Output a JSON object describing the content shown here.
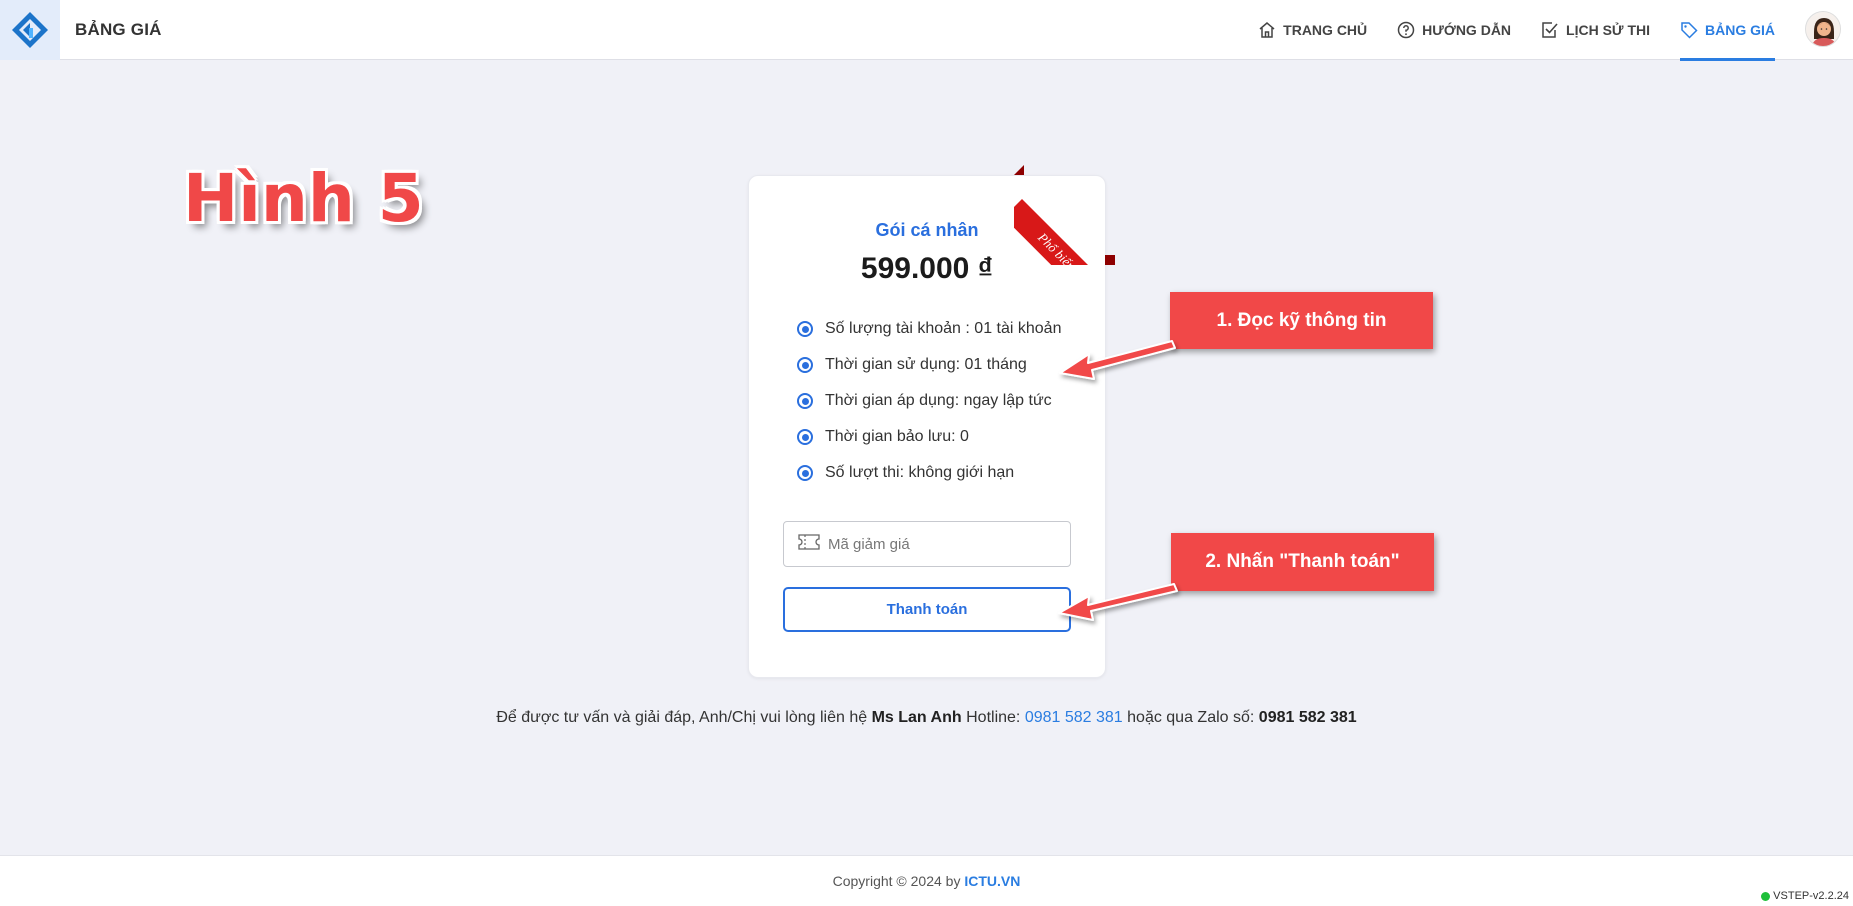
{
  "header": {
    "title": "BẢNG GIÁ",
    "nav": [
      {
        "label": "TRANG CHỦ",
        "icon": "home-icon"
      },
      {
        "label": "HƯỚNG DẪN",
        "icon": "help-icon"
      },
      {
        "label": "LỊCH SỬ THI",
        "icon": "checkbox-icon"
      },
      {
        "label": "BẢNG GIÁ",
        "icon": "price-tag-icon",
        "active": true
      }
    ]
  },
  "figure_label": "Hình 5",
  "plan": {
    "ribbon": "Phổ biến nhất",
    "name": "Gói cá nhân",
    "price": "599.000 ₫",
    "features": [
      "Số lượng tài khoản : 01 tài khoản",
      "Thời gian sử dụng: 01 tháng",
      "Thời gian áp dụng: ngay lập tức",
      "Thời gian bảo lưu: 0",
      "Số lượt thi: không giới hạn"
    ],
    "coupon_placeholder": "Mã giảm giá",
    "pay_label": "Thanh toán"
  },
  "callouts": {
    "step1": "1. Đọc kỹ thông tin",
    "step2": "2. Nhấn \"Thanh toán\""
  },
  "contact": {
    "prefix": "Để được tư vấn và giải đáp, Anh/Chị vui lòng liên hệ",
    "name": "Ms Lan Anh",
    "hotline_label": "Hotline:",
    "hotline": "0981 582 381",
    "zalo_label": "hoặc qua Zalo số:",
    "zalo": "0981 582 381"
  },
  "footer": {
    "copyright": "Copyright © 2024 by",
    "brand": "ICTU.VN",
    "version": "VSTEP-v2.2.24"
  },
  "colors": {
    "accent": "#2a7de1",
    "primary": "#2a6fde",
    "callout": "#f14848",
    "ribbon": "#d81818",
    "background": "#f0f1f7"
  }
}
